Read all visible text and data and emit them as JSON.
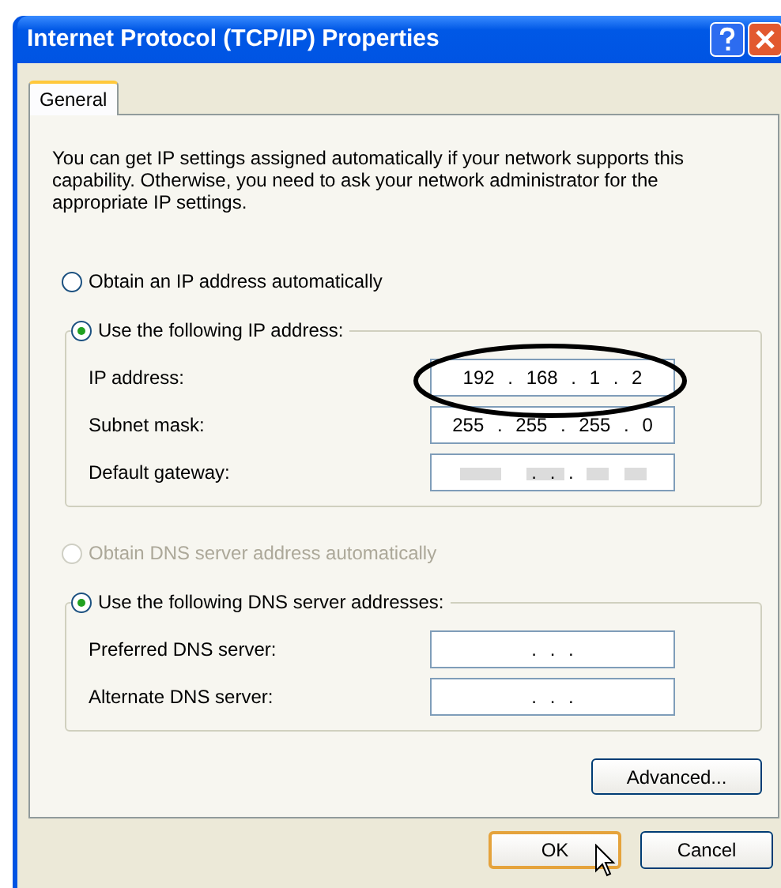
{
  "window": {
    "title": "Internet Protocol (TCP/IP) Properties"
  },
  "tabs": [
    {
      "label": "General",
      "selected": true
    }
  ],
  "intro": "You can get IP settings assigned automatically if your network supports this capability. Otherwise, you need to ask your network administrator for the appropriate IP settings.",
  "ip_options": [
    {
      "label": "Obtain an IP address automatically",
      "selected": false,
      "disabled": false
    },
    {
      "label": "Use the following IP address:",
      "selected": true,
      "disabled": false
    }
  ],
  "ip_fields": [
    {
      "label": "IP address:",
      "value": "192 . 168 . 1 . 2",
      "blurred": false
    },
    {
      "label": "Subnet mask:",
      "value": "255 . 255 . 255 . 0",
      "blurred": false
    },
    {
      "label": "Default gateway:",
      "value": ". . .",
      "blurred": true
    }
  ],
  "dns_options": [
    {
      "label": "Obtain DNS server address automatically",
      "selected": false,
      "disabled": true
    },
    {
      "label": "Use the following DNS server addresses:",
      "selected": true,
      "disabled": false
    }
  ],
  "dns_fields": [
    {
      "label": "Preferred DNS server:",
      "value": ". . .",
      "blurred": false
    },
    {
      "label": "Alternate DNS server:",
      "value": ". . .",
      "blurred": false
    }
  ],
  "advanced_button": "Advanced...",
  "buttons": [
    {
      "label": "OK",
      "focused": true
    },
    {
      "label": "Cancel",
      "focused": false
    }
  ]
}
